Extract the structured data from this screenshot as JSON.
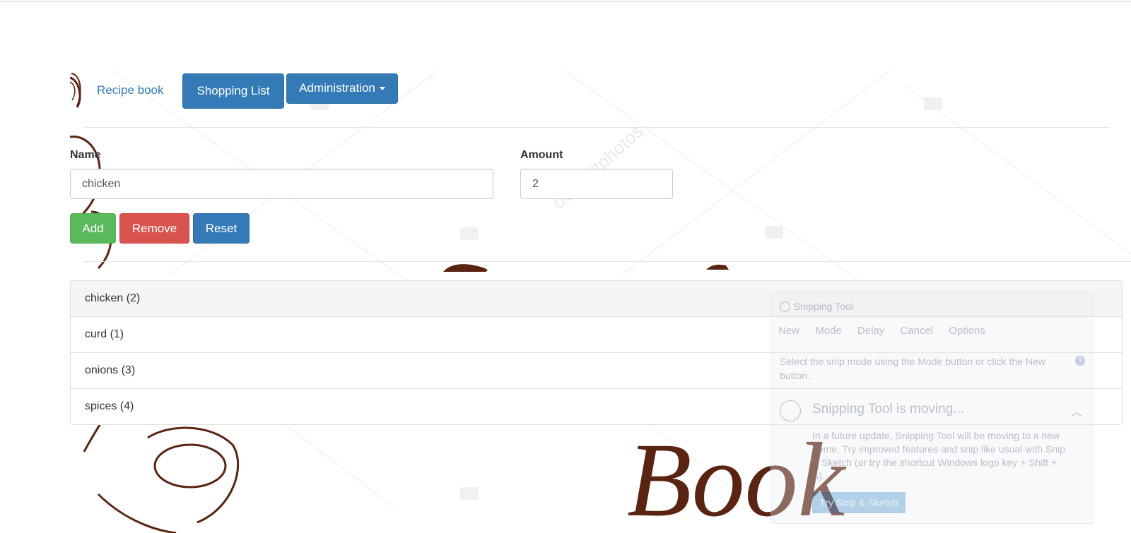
{
  "nav": {
    "brand_label": "Recipe book",
    "shopping_list_label": "Shopping List",
    "administration_label": "Administration"
  },
  "form": {
    "name_label": "Name",
    "name_value": "chicken",
    "amount_label": "Amount",
    "amount_value": "2",
    "add_label": "Add",
    "remove_label": "Remove",
    "reset_label": "Reset"
  },
  "shopping_list": [
    {
      "label": "chicken (2)",
      "selected": true
    },
    {
      "label": "curd (1)",
      "selected": false
    },
    {
      "label": "onions (3)",
      "selected": false
    },
    {
      "label": "spices (4)",
      "selected": false
    }
  ],
  "snipping_tool": {
    "title": "Snipping Tool",
    "toolbar": [
      "New",
      "Mode",
      "Delay",
      "Cancel",
      "Options"
    ],
    "hint": "Select the snip mode using the Mode button or click the New button.",
    "help_glyph": "?",
    "heading": "Snipping Tool is moving...",
    "body": "In a future update, Snipping Tool will be moving to a new home. Try improved features and snip like usual with Snip & Sketch (or try the shortcut Windows logo key + Shift + S).",
    "button_label": "Try Snip & Sketch"
  },
  "backdrop": {
    "words": [
      "Recipe",
      "Book"
    ],
    "watermark": "depositphotos",
    "ink_color": "#5a2412"
  },
  "colors": {
    "primary": "#337ab7",
    "success": "#5cb85c",
    "danger": "#d9534f",
    "link": "#337ab7"
  }
}
